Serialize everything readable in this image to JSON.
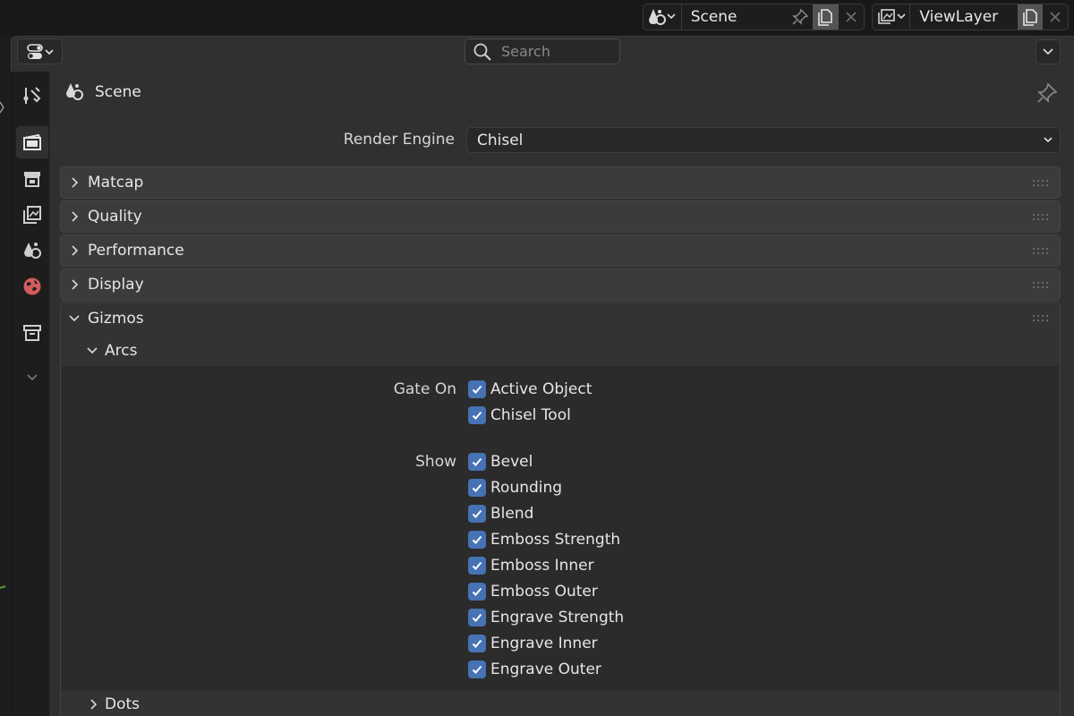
{
  "header": {
    "scene_name": "Scene",
    "view_layer_name": "ViewLayer",
    "search_placeholder": "Search"
  },
  "context": {
    "title": "Scene"
  },
  "render_engine": {
    "label": "Render Engine",
    "value": "Chisel"
  },
  "panels": [
    {
      "label": "Matcap",
      "expanded": false
    },
    {
      "label": "Quality",
      "expanded": false
    },
    {
      "label": "Performance",
      "expanded": false
    },
    {
      "label": "Display",
      "expanded": false
    },
    {
      "label": "Gizmos",
      "expanded": true
    }
  ],
  "gizmos": {
    "subpanel_arcs": "Arcs",
    "subpanel_dots": "Dots",
    "gate_on_label": "Gate On",
    "gate_on": [
      {
        "label": "Active Object",
        "checked": true
      },
      {
        "label": "Chisel Tool",
        "checked": true
      }
    ],
    "show_label": "Show",
    "show": [
      {
        "label": "Bevel",
        "checked": true
      },
      {
        "label": "Rounding",
        "checked": true
      },
      {
        "label": "Blend",
        "checked": true
      },
      {
        "label": "Emboss Strength",
        "checked": true
      },
      {
        "label": "Emboss Inner",
        "checked": true
      },
      {
        "label": "Emboss Outer",
        "checked": true
      },
      {
        "label": "Engrave Strength",
        "checked": true
      },
      {
        "label": "Engrave Inner",
        "checked": true
      },
      {
        "label": "Engrave Outer",
        "checked": true
      }
    ]
  },
  "tabs": [
    {
      "name": "tool-tab",
      "icon": "tool-icon"
    },
    {
      "name": "render-tab",
      "icon": "render-icon"
    },
    {
      "name": "output-tab",
      "icon": "output-icon"
    },
    {
      "name": "view-layer-tab",
      "icon": "view-layer-icon"
    },
    {
      "name": "scene-tab",
      "icon": "scene-icon"
    },
    {
      "name": "world-tab",
      "icon": "world-icon"
    },
    {
      "name": "collection-tab",
      "icon": "collection-icon"
    }
  ],
  "colors": {
    "checkbox": "#4772b3",
    "world_icon": "#d15c5c",
    "panel_bg": "#303030"
  }
}
